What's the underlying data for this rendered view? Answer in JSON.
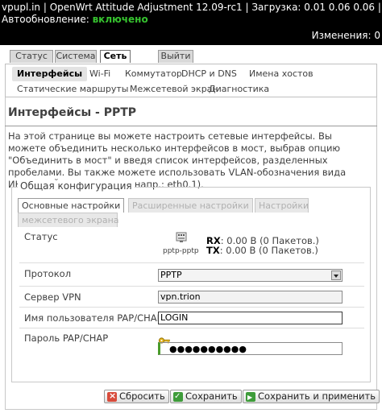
{
  "header": {
    "line1": "vpupl.in | OpenWrt Attitude Adjustment 12.09-rc1 | Загрузка: 0.01 0.06 0.06 |",
    "autorefresh_label": "Автообновление:",
    "autorefresh_value": "включено",
    "changes": "Изменения: 0"
  },
  "main_tabs": [
    {
      "label": "Статус"
    },
    {
      "label": "Система"
    },
    {
      "label": "Сеть"
    },
    {
      "label": "Выйти"
    }
  ],
  "sub_tabs": [
    {
      "label": "Интерфейсы"
    },
    {
      "label": "Wi-Fi"
    },
    {
      "label": "Коммутатор"
    },
    {
      "label": "DHCP и DNS"
    },
    {
      "label": "Имена хостов"
    },
    {
      "label": "Статические маршруты"
    },
    {
      "label": "Межсетевой экран"
    },
    {
      "label": "Диагностика"
    }
  ],
  "page": {
    "title": "Интерфейсы - PPTP",
    "description": "На этой странице вы можете настроить сетевые интерфейсы. Вы можете объединить несколько интерфейсов в мост, выбрав опцию \"Объединить в мост\" и введя список интерфейсов, разделенных пробелами. Вы также можете использовать VLAN-обозначения вида ИНТЕРФЕЙС.НОМЕРVLAN (напр.: eth0.1)."
  },
  "fieldset": {
    "legend": "Общая конфигурация",
    "tabs": [
      {
        "label": "Основные настройки"
      },
      {
        "label": "Расширенные настройки"
      },
      {
        "label": "Настройки"
      },
      {
        "label": "межсетевого экрана"
      }
    ]
  },
  "status": {
    "label": "Статус",
    "iface_name": "pptp-pptp",
    "rx_label": "RX",
    "rx_value": ": 0.00 В (0 Пакетов.)",
    "tx_label": "TX",
    "tx_value": ": 0.00 В (0 Пакетов.)"
  },
  "form": {
    "protocol_label": "Протокол",
    "protocol_value": "PPTP",
    "server_label": "Сервер VPN",
    "server_value": "vpn.trion",
    "username_label": "Имя пользователя PAP/CHAP",
    "username_value": "LOGIN",
    "password_label": "Пароль PAP/CHAP",
    "password_value": "●●●●●●●●●●"
  },
  "buttons": {
    "reset": "Сбросить",
    "save": "Сохранить",
    "save_apply": "Сохранить и применить"
  },
  "colors": {
    "header_bg": "#000000",
    "enabled_green": "#36c32f"
  }
}
